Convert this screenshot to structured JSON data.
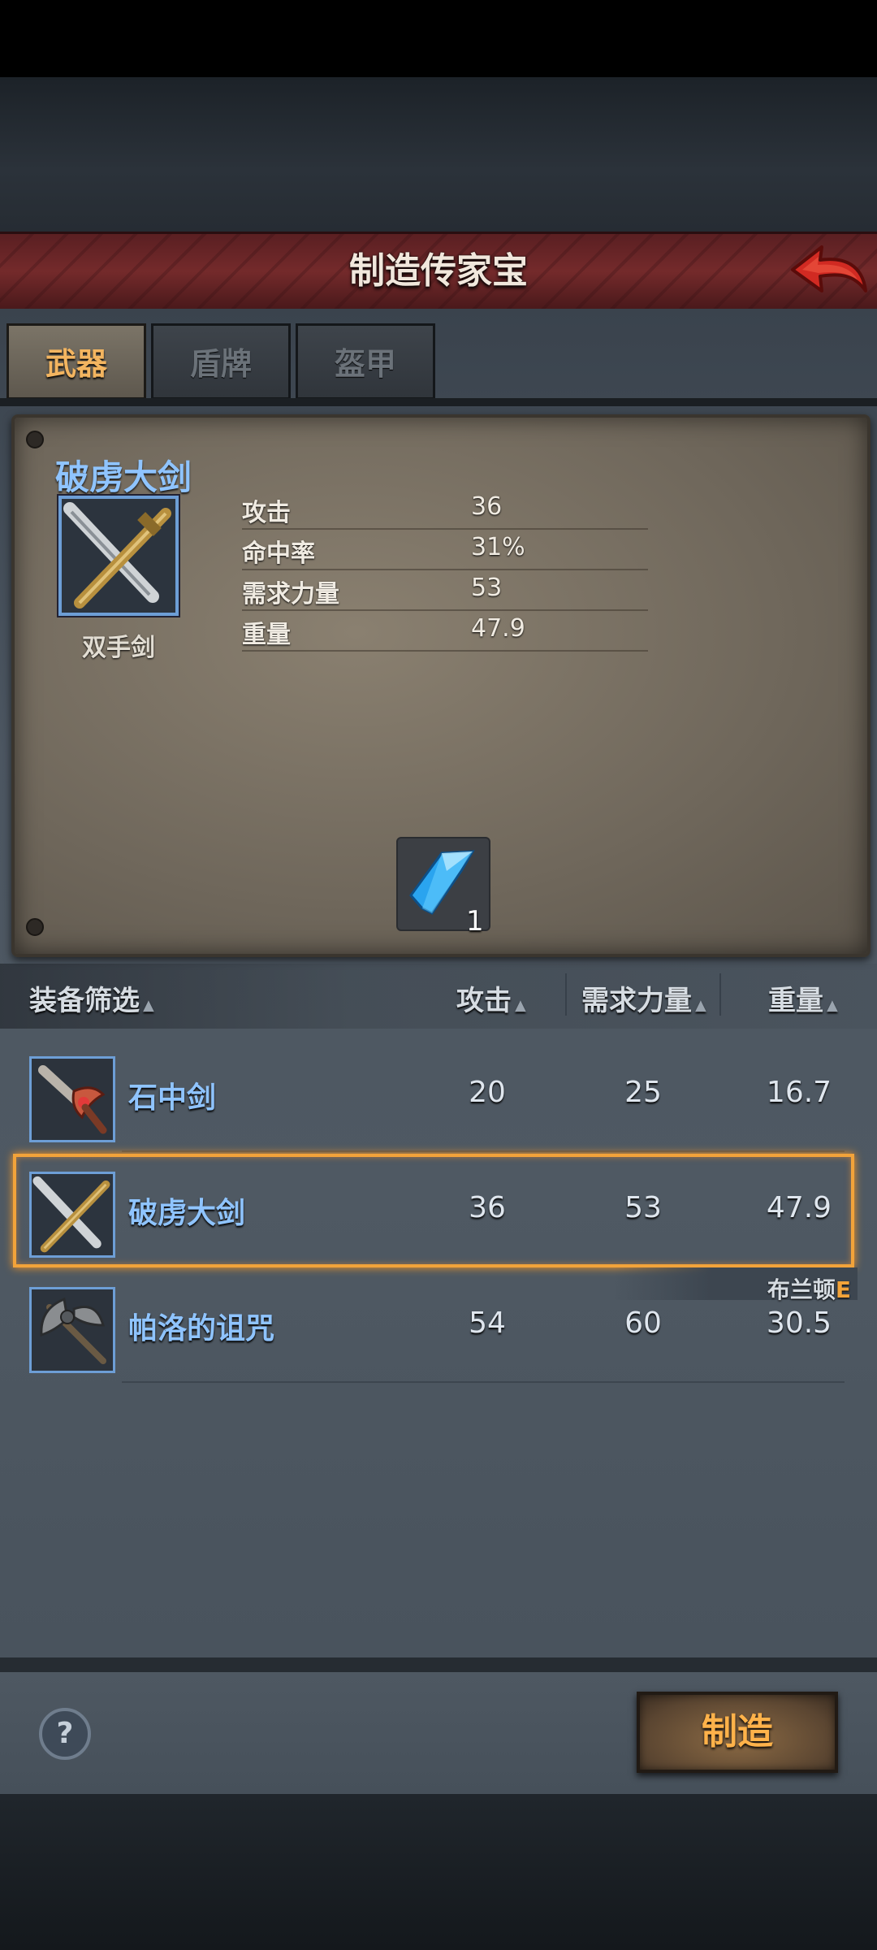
{
  "header": {
    "title": "制造传家宝"
  },
  "tabs": [
    {
      "label": "武器",
      "active": true
    },
    {
      "label": "盾牌",
      "active": false
    },
    {
      "label": "盔甲",
      "active": false
    }
  ],
  "detail": {
    "name": "破虏大剑",
    "type": "双手剑",
    "icon": "greatsword-icon",
    "stats": [
      {
        "label": "攻击",
        "value": "36"
      },
      {
        "label": "命中率",
        "value": "31%"
      },
      {
        "label": "需求力量",
        "value": "53"
      },
      {
        "label": "重量",
        "value": "47.9"
      }
    ],
    "material": {
      "icon": "blue-crystal-icon",
      "count": "1"
    }
  },
  "list": {
    "headers": {
      "name": "装备筛选",
      "attack": "攻击",
      "strength": "需求力量",
      "weight": "重量"
    },
    "rows": [
      {
        "name": "石中剑",
        "icon": "ornate-sword-icon",
        "attack": "20",
        "strength": "25",
        "weight": "16.7"
      },
      {
        "name": "破虏大剑",
        "icon": "greatsword-icon",
        "attack": "36",
        "strength": "53",
        "weight": "47.9",
        "selected": true
      },
      {
        "name": "帕洛的诅咒",
        "icon": "battle-axe-icon",
        "attack": "54",
        "strength": "60",
        "weight": "30.5"
      }
    ],
    "owner": {
      "name": "布兰顿",
      "grade": "E"
    }
  },
  "footer": {
    "help_label": "?",
    "craft_label": "制造"
  },
  "colors": {
    "accent_orange": "#f2a33a",
    "item_blue": "#8fc4ff",
    "banner_red": "#742a2b"
  }
}
